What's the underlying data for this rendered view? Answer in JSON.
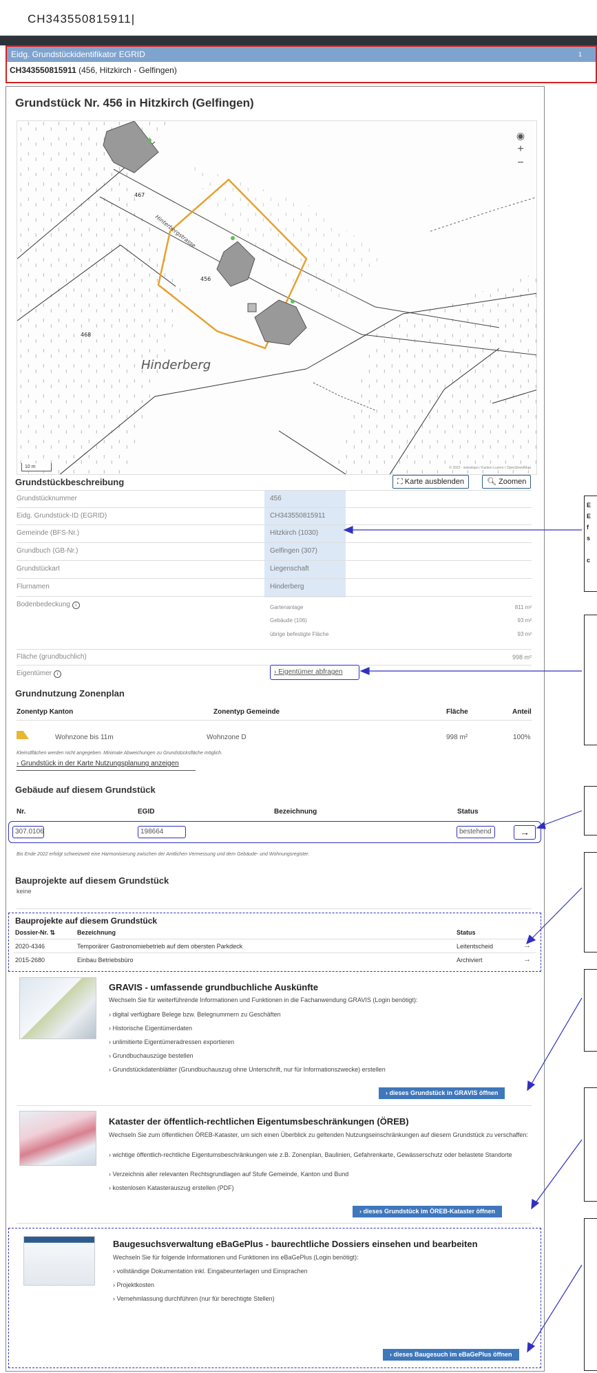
{
  "search": {
    "value": "CH343550815911"
  },
  "result": {
    "header": "Eidg. Grundstückidentifikator EGRID",
    "count": "1",
    "id": "CH343550815911",
    "detail": " (456, Hitzkirch - Gelfingen)"
  },
  "parcel": {
    "title": "Grundstück Nr. 456 in Hitzkirch (Gelfingen)",
    "map": {
      "labels": {
        "p467": "467",
        "p456": "456",
        "p468": "468",
        "street": "Hinterbergstrasse",
        "place": "Hinderberg"
      },
      "scale": "10 m",
      "copyright": "© 2023 · swisstopo / Kanton Luzern / OpenStreetMap"
    }
  },
  "description": {
    "title": "Grundstückbeschreibung",
    "btn_hide_map": "Karte ausblenden",
    "btn_zoom": "Zoomen",
    "rows": [
      {
        "label": "Grundstücknummer",
        "value": "456"
      },
      {
        "label": "Eidg. Grundstück-ID (EGRID)",
        "value": "CH343550815911"
      },
      {
        "label": "Gemeinde (BFS-Nr.)",
        "value": "Hitzkirch (1030)"
      },
      {
        "label": "Grundbuch (GB-Nr.)",
        "value": "Gelfingen (307)"
      },
      {
        "label": "Grundstückart",
        "value": "Liegenschaft"
      },
      {
        "label": "Flurnamen",
        "value": "Hinderberg"
      }
    ],
    "bodenbedeckung": {
      "label": "Bodenbedeckung",
      "items": [
        {
          "name": "Gartenanlage",
          "value": "811 m²"
        },
        {
          "name": "Gebäude (106)",
          "value": "93 m²"
        },
        {
          "name": "übrige befestigte Fläche",
          "value": "93 m²"
        }
      ]
    },
    "flaeche": {
      "label": "Fläche (grundbuchlich)",
      "value": "998 m²"
    },
    "eigentuemer": {
      "label": "Eigentümer",
      "link": "Eigentümer abfragen"
    }
  },
  "zonen": {
    "title": "Grundnutzung Zonenplan",
    "headers": [
      "Zonentyp Kanton",
      "Zonentyp Gemeinde",
      "Fläche",
      "Anteil"
    ],
    "row": [
      "Wohnzone bis 11m",
      "Wohnzone D",
      "998 m²",
      "100%"
    ],
    "note": "Kleinstflächen werden nicht angegeben. Minimale Abweichungen zu Grundstücksfläche möglich.",
    "link": "Grundstück in der Karte Nutzungsplanung anzeigen"
  },
  "gebaeude": {
    "title": "Gebäude auf diesem Grundstück",
    "headers": [
      "Nr.",
      "EGID",
      "Bezeichnung",
      "Status"
    ],
    "row": [
      "307.0106",
      "198664",
      "",
      "bestehend"
    ],
    "arrow": "→",
    "note": "Bis Ende 2022 erfolgt schweizweit eine Harmonisierung zwischen der Amtlichen Vermessung und dem Gebäude- und Wohnungsregister."
  },
  "bauprojekte1": {
    "title": "Bauprojekte auf diesem Grundstück",
    "value": "keine"
  },
  "bauprojekte2": {
    "title": "Bauprojekte auf diesem Grundstück",
    "headers": [
      "Dossier-Nr.",
      "Bezeichnung",
      "Status"
    ],
    "rows": [
      [
        "2020-4346",
        "Temporärer Gastronomiebetrieb auf dem obersten Parkdeck",
        "Leitentscheid"
      ],
      [
        "2015-2680",
        "Einbau Betriebsbüro",
        "Archiviert"
      ]
    ]
  },
  "gravis": {
    "title": "GRAVIS - umfassende grundbuchliche Auskünfte",
    "desc": "Wechseln Sie für weiterführende Informationen und Funktionen in die Fachanwendung GRAVIS (Login benötigt):",
    "bullets": [
      "digital verfügbare Belege bzw. Belegnummern zu Geschäften",
      "Historische Eigentümerdaten",
      "unlimitierte Eigentümeradressen exportieren",
      "Grundbuchauszüge bestellen",
      "Grundstückdatenblätter (Grundbuchauszug ohne Unterschrift, nur für Informationszwecke) erstellen"
    ],
    "button": "dieses Grundstück in GRAVIS öffnen"
  },
  "oereb": {
    "title": "Kataster der öffentlich-rechtlichen Eigentumsbeschränkungen (ÖREB)",
    "desc": "Wechseln Sie zum öffentlichen ÖREB-Kataster, um sich einen Überblick zu geltenden Nutzungseinschränkungen auf diesem Grundstück zu verschaffen:",
    "bullets": [
      "wichtige öffentlich-rechtliche Eigentumsbeschränkungen wie z.B. Zonenplan, Baulinien, Gefahrenkarte, Gewässerschutz oder belastete Standorte",
      "Verzeichnis aller relevanten Rechtsgrundlagen auf Stufe Gemeinde, Kanton und Bund",
      "kostenlosen Katasterauszug erstellen (PDF)"
    ],
    "button": "dieses Grundstück im ÖREB-Kataster öffnen"
  },
  "ebage": {
    "title": "Baugesuchsverwaltung eBaGePlus - baurechtliche Dossiers einsehen und bearbeiten",
    "desc": "Wechseln Sie für folgende Informationen und Funktionen ins eBaGePlus (Login benötigt):",
    "bullets": [
      "vollständige Dokumentation inkl. Eingabeunterlagen und Einsprachen",
      "Projektkosten",
      "Vernehmlassung durchführen (nur für berechtigte Stellen)"
    ],
    "button": "dieses Baugesuch im eBaGePlus öffnen"
  },
  "annotations": {
    "a1": [
      "E",
      "E",
      "f",
      "s",
      "",
      "c"
    ]
  },
  "colors": {
    "accent": "#3f77bb",
    "highlight": "#dce8f5",
    "callout": "#3030c0",
    "error": "#d62020",
    "parcel": "#e8a030"
  }
}
